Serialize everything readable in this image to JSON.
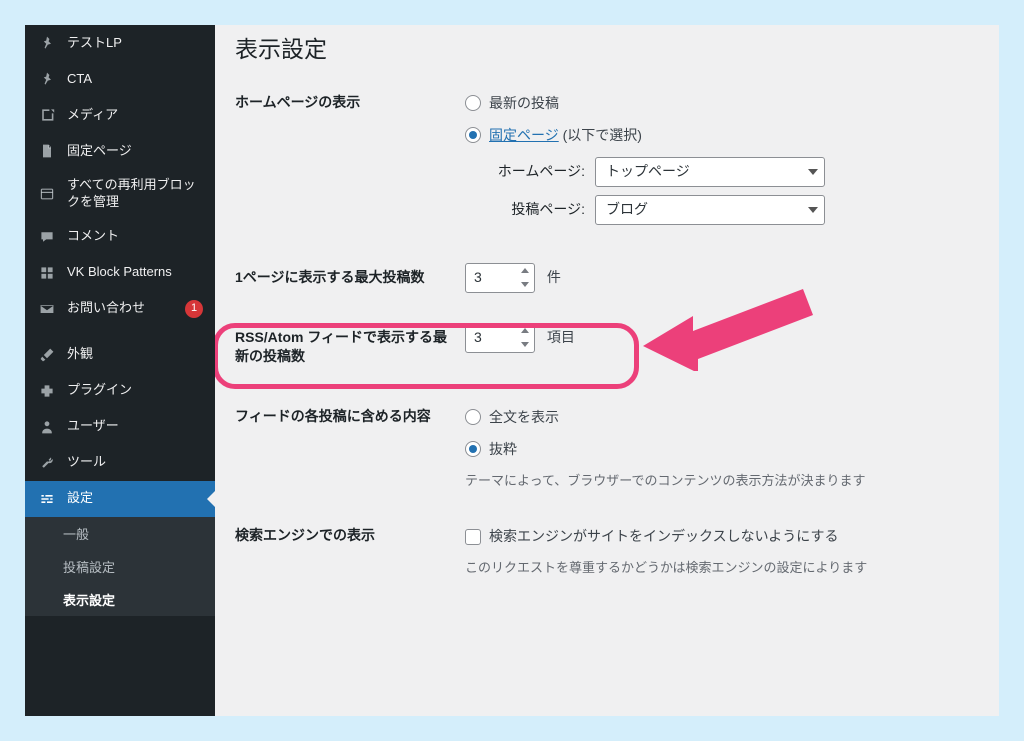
{
  "page": {
    "title": "表示設定"
  },
  "sidebar": {
    "items": [
      {
        "label": "テストLP"
      },
      {
        "label": "CTA"
      },
      {
        "label": "メディア"
      },
      {
        "label": "固定ページ"
      },
      {
        "label": "すべての再利用ブロックを管理"
      },
      {
        "label": "コメント"
      },
      {
        "label": "VK Block Patterns"
      },
      {
        "label": "お問い合わせ",
        "badge": "1"
      },
      {
        "label": "外観"
      },
      {
        "label": "プラグイン"
      },
      {
        "label": "ユーザー"
      },
      {
        "label": "ツール"
      },
      {
        "label": "設定"
      }
    ],
    "submenu": [
      {
        "label": "一般"
      },
      {
        "label": "投稿設定"
      },
      {
        "label": "表示設定"
      }
    ]
  },
  "settings": {
    "homepage_display": {
      "label": "ホームページの表示",
      "opt_latest": "最新の投稿",
      "opt_static_link": "固定ページ",
      "opt_static_suffix": " (以下で選択)",
      "homepage_label": "ホームページ:",
      "homepage_value": "トップページ",
      "posts_label": "投稿ページ:",
      "posts_value": "ブログ"
    },
    "posts_per_page": {
      "label": "1ページに表示する最大投稿数",
      "value": "3",
      "unit": "件"
    },
    "rss_items": {
      "label": "RSS/Atom フィードで表示する最新の投稿数",
      "value": "3",
      "unit": "項目"
    },
    "feed_content": {
      "label": "フィードの各投稿に含める内容",
      "opt_full": "全文を表示",
      "opt_excerpt": "抜粋",
      "desc": "テーマによって、ブラウザーでのコンテンツの表示方法が決まります"
    },
    "search_engine": {
      "label": "検索エンジンでの表示",
      "checkbox_label": "検索エンジンがサイトをインデックスしないようにする",
      "desc": "このリクエストを尊重するかどうかは検索エンジンの設定によります"
    }
  }
}
